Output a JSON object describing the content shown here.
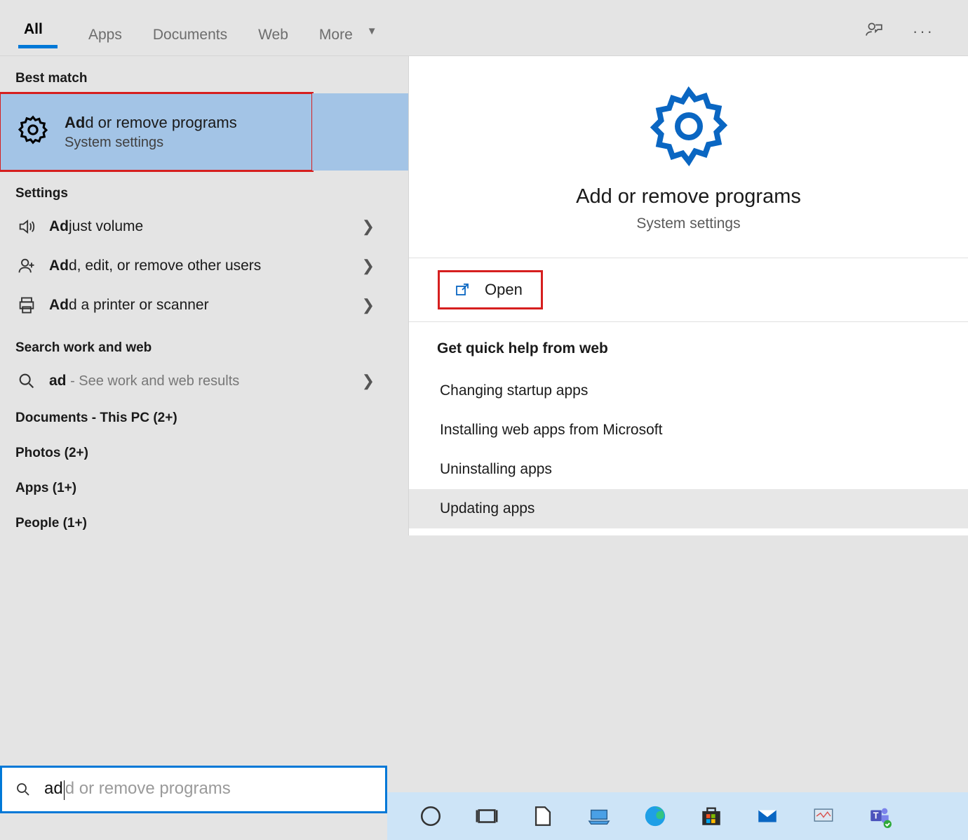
{
  "topTabs": {
    "all": "All",
    "apps": "Apps",
    "documents": "Documents",
    "web": "Web",
    "more": "More"
  },
  "sections": {
    "bestMatch": "Best match",
    "settings": "Settings",
    "searchWeb": "Search work and web",
    "documentsThisPC": "Documents - This PC (2+)",
    "photos": "Photos (2+)",
    "apps": "Apps (1+)",
    "people": "People (1+)"
  },
  "bestMatch": {
    "titlePrefix": "Ad",
    "titleRest": "d or remove programs",
    "subtitle": "System settings"
  },
  "settingsItems": [
    {
      "bold": "Ad",
      "rest": "just volume",
      "icon": "volume"
    },
    {
      "bold": "Ad",
      "rest": "d, edit, or remove other users",
      "icon": "user-plus"
    },
    {
      "bold": "Ad",
      "rest": "d a printer or scanner",
      "icon": "printer"
    }
  ],
  "webSearch": {
    "bold": "ad",
    "rest": " - See work and web results"
  },
  "detail": {
    "title": "Add or remove programs",
    "subtitle": "System settings",
    "openLabel": "Open",
    "helpHeader": "Get quick help from web",
    "helpItems": [
      "Changing startup apps",
      "Installing web apps from Microsoft",
      "Uninstalling apps",
      "Updating apps"
    ]
  },
  "searchInput": {
    "typed": "ad",
    "ghost": "d or remove programs"
  }
}
